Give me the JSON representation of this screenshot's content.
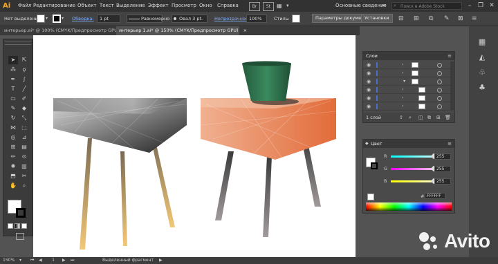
{
  "app": {
    "logo": "Ai",
    "br_badge": "Br",
    "st_badge": "St"
  },
  "menu": [
    "Файл",
    "Редактирование",
    "Объект",
    "Текст",
    "Выделение",
    "Эффект",
    "Просмотр",
    "Окно",
    "Справка"
  ],
  "workspace": "Основные сведения",
  "search": {
    "placeholder": "Поиск в Adobe Stock"
  },
  "window_controls": {
    "minimize": "–",
    "restore": "❐",
    "close": "✕"
  },
  "controlbar": {
    "no_selection": "Нет выделения",
    "stroke_label": "Обводка:",
    "stroke_value": "1 pt",
    "profile": "Равномерно",
    "brush": "Овал 3 pt.",
    "opacity_label": "Непрозрачность:",
    "opacity_value": "100%",
    "style_label": "Стиль:",
    "doc_setup": "Параметры документа",
    "prefs": "Установки"
  },
  "tabs": [
    {
      "label": "интерьер.ai* @ 100% (CMYK/Предпросмотр GPU)",
      "close": "×"
    },
    {
      "label": "интерьер 1.ai* @ 150% (CMYK/Предпросмотр GPU)",
      "close": "×"
    }
  ],
  "layers_panel": {
    "title": "Слои",
    "footer": "1 слой",
    "rows": 6
  },
  "color_panel": {
    "title": "Цвет",
    "channels": [
      {
        "name": "R",
        "value": "255"
      },
      {
        "name": "G",
        "value": "255"
      },
      {
        "name": "B",
        "value": "255"
      }
    ],
    "hex_prefix": "#",
    "hex": "FFFFFF"
  },
  "status": {
    "zoom": "150%",
    "page": "1",
    "selection": "Выделенный фрагмент"
  },
  "watermark": "Avito",
  "colors": {
    "accent": "#f5a623",
    "layer_blue": "#4a6fd0",
    "bucket": "#2e6b4a",
    "stool_orange": "#e98a5f"
  }
}
